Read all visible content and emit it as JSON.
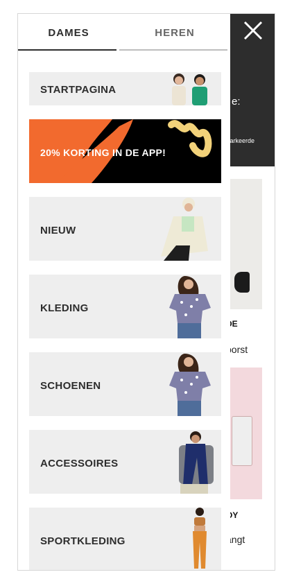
{
  "tabs": {
    "women": "DAMES",
    "men": "HEREN",
    "active": "DAMES"
  },
  "menu_items": [
    {
      "label": "STARTPAGINA"
    },
    {
      "label": "20% KORTING IN DE APP!"
    },
    {
      "label": "NIEUW"
    },
    {
      "label": "KLEDING"
    },
    {
      "label": "SCHOENEN"
    },
    {
      "label": "ACCESSOIRES"
    },
    {
      "label": "SPORTKLEDING"
    }
  ],
  "background": {
    "peek_text_1": "e:",
    "peek_text_2": "markeerde",
    "product_1_title": "DE",
    "product_1_desc": "borst",
    "product_2_title": "OY",
    "product_2_desc": "angt"
  },
  "colors": {
    "dark": "#2d2d2d",
    "tile": "#eeeeee",
    "promo_bg": "#000000",
    "promo_orange": "#f26a2e",
    "promo_yellow": "#f2d27a"
  },
  "icons": {
    "close": "close-icon"
  }
}
